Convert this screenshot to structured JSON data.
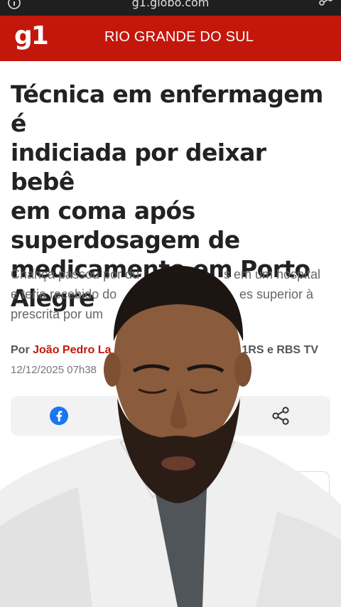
{
  "browser": {
    "url": "g1.globo.com",
    "icons": [
      "info-icon",
      "share-icon"
    ]
  },
  "header": {
    "logo": "g1",
    "section": "RIO GRANDE DO SUL",
    "brand_color": "#c4170c"
  },
  "article": {
    "headline_lines": [
      "Técnica em enfermagem é",
      "indiciada por deixar bebê",
      "em coma após",
      "superdosagem de",
      "medicamento em Porto",
      "Alegre"
    ],
    "subtitle_visible": {
      "line1_start": "Criança passou por du",
      "line1_end": "s em um hospital",
      "line2_start": "e teria recebido do",
      "line2_end": "es superior à",
      "line3_start": "prescrita por um"
    },
    "byline": {
      "prefix": "Por",
      "author_visible": "João Pedro La",
      "source_visible": "1RS e RBS TV"
    },
    "dateline_visible": "12/12/2025 07h38"
  },
  "share": {
    "icons": [
      "facebook-icon",
      "share-icon"
    ]
  },
  "overlay": {
    "description_icon": "presenter-video"
  }
}
